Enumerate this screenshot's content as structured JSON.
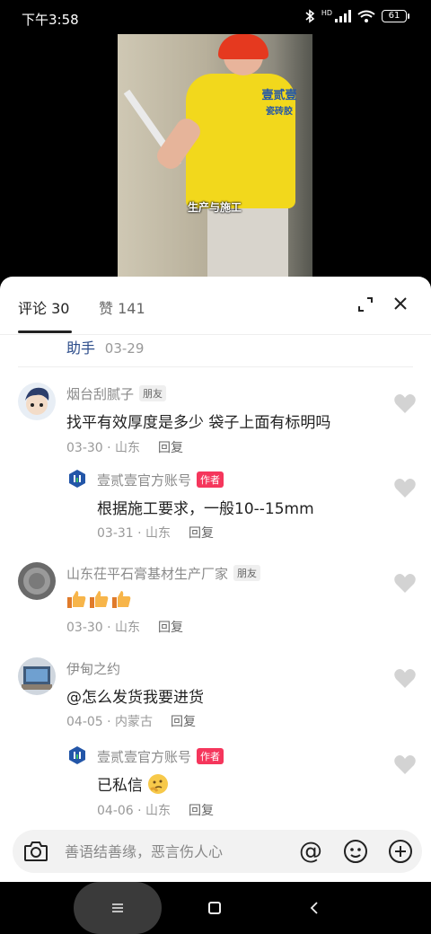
{
  "status_bar": {
    "time": "下午3:58",
    "battery": "61",
    "network": "HD"
  },
  "video": {
    "shirt_text_line1": "壹贰壹",
    "shirt_text_line2": "瓷砖胶",
    "caption": "生产与施工"
  },
  "tabs": {
    "comments_label": "评论 30",
    "likes_label": "赞 141"
  },
  "previous_comment_tail": {
    "user": "助手",
    "date": "03-29"
  },
  "comments": [
    {
      "name": "烟台刮腻子",
      "badge": "朋友",
      "text": "找平有效厚度是多少 袋子上面有标明吗",
      "date": "03-30",
      "location": "山东",
      "reply": "回复",
      "dot": "·"
    },
    {
      "name": "壹贰壹官方账号",
      "badge": "作者",
      "text": "根据施工要求，一般10--15mm",
      "date": "03-31",
      "location": "山东",
      "reply": "回复",
      "dot": "·"
    },
    {
      "name": "山东茌平石膏基材生产厂家",
      "badge": "朋友",
      "text": "",
      "date": "03-30",
      "location": "山东",
      "reply": "回复",
      "dot": "·"
    },
    {
      "name": "伊甸之约",
      "badge": "",
      "text": "@怎么发货我要进货",
      "date": "04-05",
      "location": "内蒙古",
      "reply": "回复",
      "dot": "·"
    },
    {
      "name": "壹贰壹官方账号",
      "badge": "作者",
      "text": "已私信",
      "date": "04-06",
      "location": "山东",
      "reply": "回复",
      "dot": "·"
    }
  ],
  "input": {
    "placeholder": "善语结善缘，恶言伤人心",
    "at_symbol": "@"
  },
  "colors": {
    "author_badge": "#f5365c",
    "name_gray": "#8a8a8a",
    "link_blue": "#2c4c8a"
  }
}
